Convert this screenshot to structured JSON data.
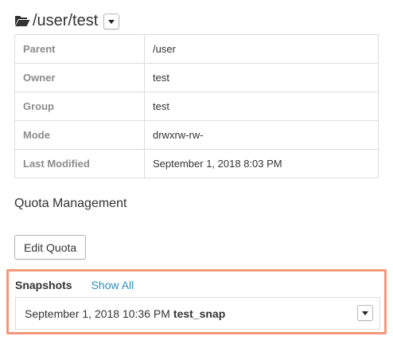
{
  "header": {
    "path": "/user/test",
    "folder_icon": "folder-open-icon",
    "menu_icon": "chevron-down-icon"
  },
  "info": {
    "rows": [
      {
        "key": "Parent",
        "value": "/user"
      },
      {
        "key": "Owner",
        "value": "test"
      },
      {
        "key": "Group",
        "value": "test"
      },
      {
        "key": "Mode",
        "value": "drwxrw-rw-"
      },
      {
        "key": "Last Modified",
        "value": "September 1, 2018 8:03 PM"
      }
    ]
  },
  "quota": {
    "title": "Quota Management",
    "edit_label": "Edit Quota"
  },
  "snapshots": {
    "label": "Snapshots",
    "show_all": "Show All",
    "highlight_color": "#f4987a",
    "link_color": "#2a8fbd",
    "items": [
      {
        "date": "September 1, 2018 10:36 PM",
        "name": "test_snap"
      }
    ]
  }
}
